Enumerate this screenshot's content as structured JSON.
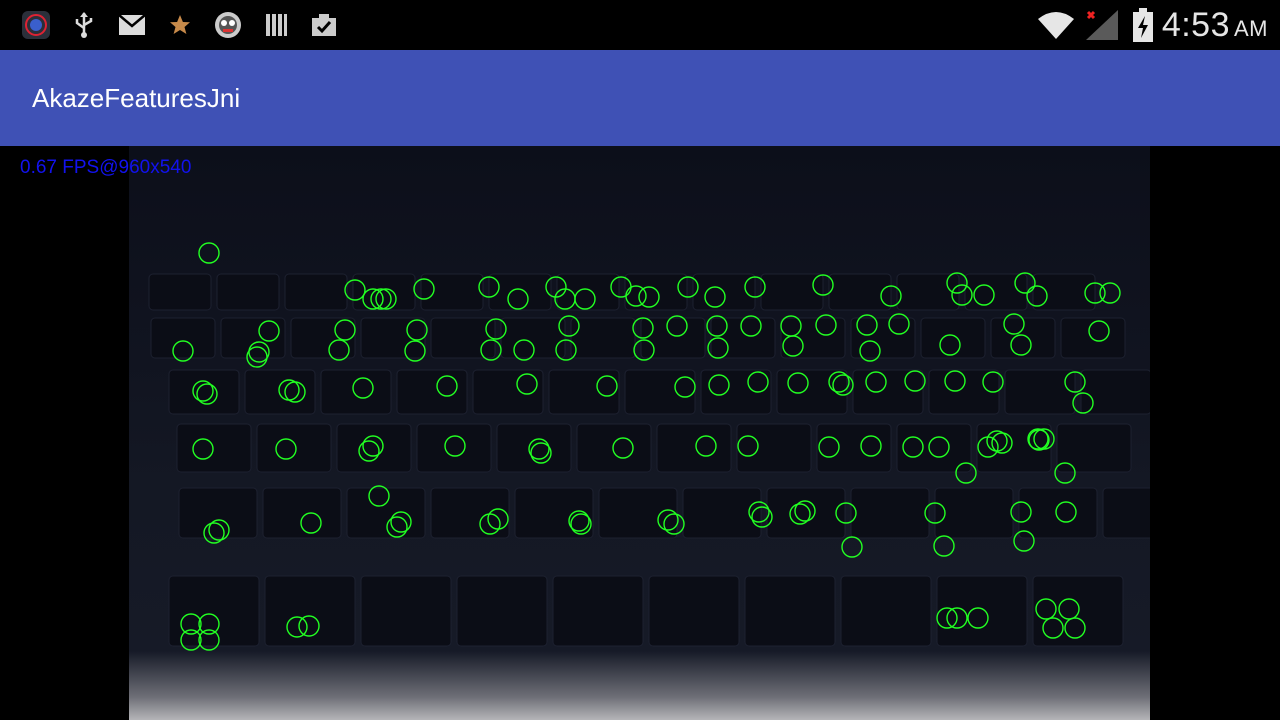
{
  "status_bar": {
    "icons": [
      "app-notification-icon",
      "usb-icon",
      "gmail-icon",
      "star-icon",
      "face-app-icon",
      "library-icon",
      "clipboard-check-icon",
      "wifi-icon",
      "signal-icon",
      "battery-icon"
    ],
    "time": "4:53",
    "ampm": "AM"
  },
  "app_bar": {
    "title": "AkazeFeaturesJni"
  },
  "camera": {
    "fps_label": "0.67 FPS@960x540",
    "feature_color": "#22ff22"
  }
}
